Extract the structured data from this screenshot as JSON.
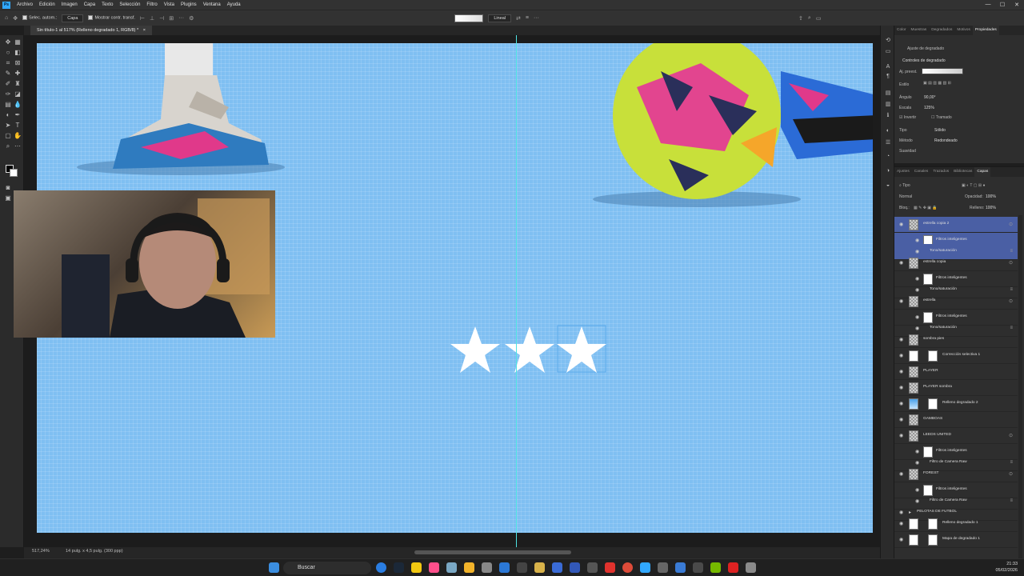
{
  "app": {
    "logo": "Ps"
  },
  "menu": [
    "Archivo",
    "Edición",
    "Imagen",
    "Capa",
    "Texto",
    "Selección",
    "Filtro",
    "Vista",
    "Plugins",
    "Ventana",
    "Ayuda"
  ],
  "window_controls": [
    "—",
    "☐",
    "✕"
  ],
  "options_bar": {
    "auto_select_label": "Selec. autom.:",
    "auto_select_target": "Capa",
    "transform_controls_label": "Mostrar contr. transf.",
    "gradient_mode": "Lineal",
    "more": "···"
  },
  "document_tab": {
    "title": "Sin título-1 al 517% (Relleno degradado 1, RGB/8) *",
    "close": "×"
  },
  "status": {
    "zoom": "517,24%",
    "size": "14 pulg. x 4,5 pulg. (300 ppp)"
  },
  "canvas": {
    "background_color": "#7fbff2",
    "stars_count": 3
  },
  "properties": {
    "tabs": [
      "Color",
      "Muestras",
      "Degradados",
      "Motivos",
      "Propiedades"
    ],
    "active_tab": "Propiedades",
    "header": "Ajuste de degradado",
    "section": "Controles de degradado",
    "preset_label": "Aj. preest.",
    "style_label": "Estilo",
    "angle_label": "Ángulo",
    "angle_value": "90,00°",
    "scale_label": "Escala",
    "scale_value": "125%",
    "invert_label": "Invertir",
    "dither_label": "Tramado",
    "type_label": "Tipo",
    "type_value": "Sólido",
    "method_label": "Método",
    "method_value": "Redondeado",
    "smooth_label": "Suavidad"
  },
  "layers_panel": {
    "tabs": [
      "Ajustes",
      "Canales",
      "Trazados",
      "Bibliotecas",
      "Capas"
    ],
    "active_tab": "Capas",
    "filter_label": "Tipo",
    "blend_mode": "Normal",
    "opacity_label": "Opacidad:",
    "opacity_value": "100%",
    "lock_label": "Bloq.:",
    "fill_label": "Relleno:",
    "fill_value": "100%",
    "layers": [
      {
        "name": "estrella copia 2",
        "type": "smart",
        "selected": true
      },
      {
        "name": "Filtros inteligentes",
        "type": "filters",
        "selected": true
      },
      {
        "name": "Tono/saturación",
        "type": "effect",
        "selected": true
      },
      {
        "name": "estrella copia",
        "type": "smart"
      },
      {
        "name": "Filtros inteligentes",
        "type": "filters"
      },
      {
        "name": "Tono/saturación",
        "type": "effect"
      },
      {
        "name": "estrella",
        "type": "smart"
      },
      {
        "name": "Filtros inteligentes",
        "type": "filters"
      },
      {
        "name": "Tono/saturación",
        "type": "effect"
      },
      {
        "name": "sombra pies",
        "type": "pixel"
      },
      {
        "name": "Corrección selectiva 1",
        "type": "adjust"
      },
      {
        "name": "PLAYER",
        "type": "pixel"
      },
      {
        "name": "PLAYER sombra",
        "type": "pixel"
      },
      {
        "name": "Relleno degradado 2",
        "type": "fill"
      },
      {
        "name": "GAMBOAS",
        "type": "pixel"
      },
      {
        "name": "LEEDS UNITED",
        "type": "smart"
      },
      {
        "name": "Filtros inteligentes",
        "type": "filters"
      },
      {
        "name": "Filtro de Camera Raw",
        "type": "effect"
      },
      {
        "name": "FOREST",
        "type": "smart"
      },
      {
        "name": "Filtros inteligentes",
        "type": "filters"
      },
      {
        "name": "Filtro de Camera Raw",
        "type": "effect"
      },
      {
        "name": "PELOTAS DE FUTBOL",
        "type": "group"
      },
      {
        "name": "Relleno degradado 1",
        "type": "adjust"
      },
      {
        "name": "Mapa de degradado 1",
        "type": "adjust"
      }
    ]
  },
  "taskbar": {
    "search": "Buscar",
    "time": "21:33",
    "date": "05/02/2026"
  }
}
